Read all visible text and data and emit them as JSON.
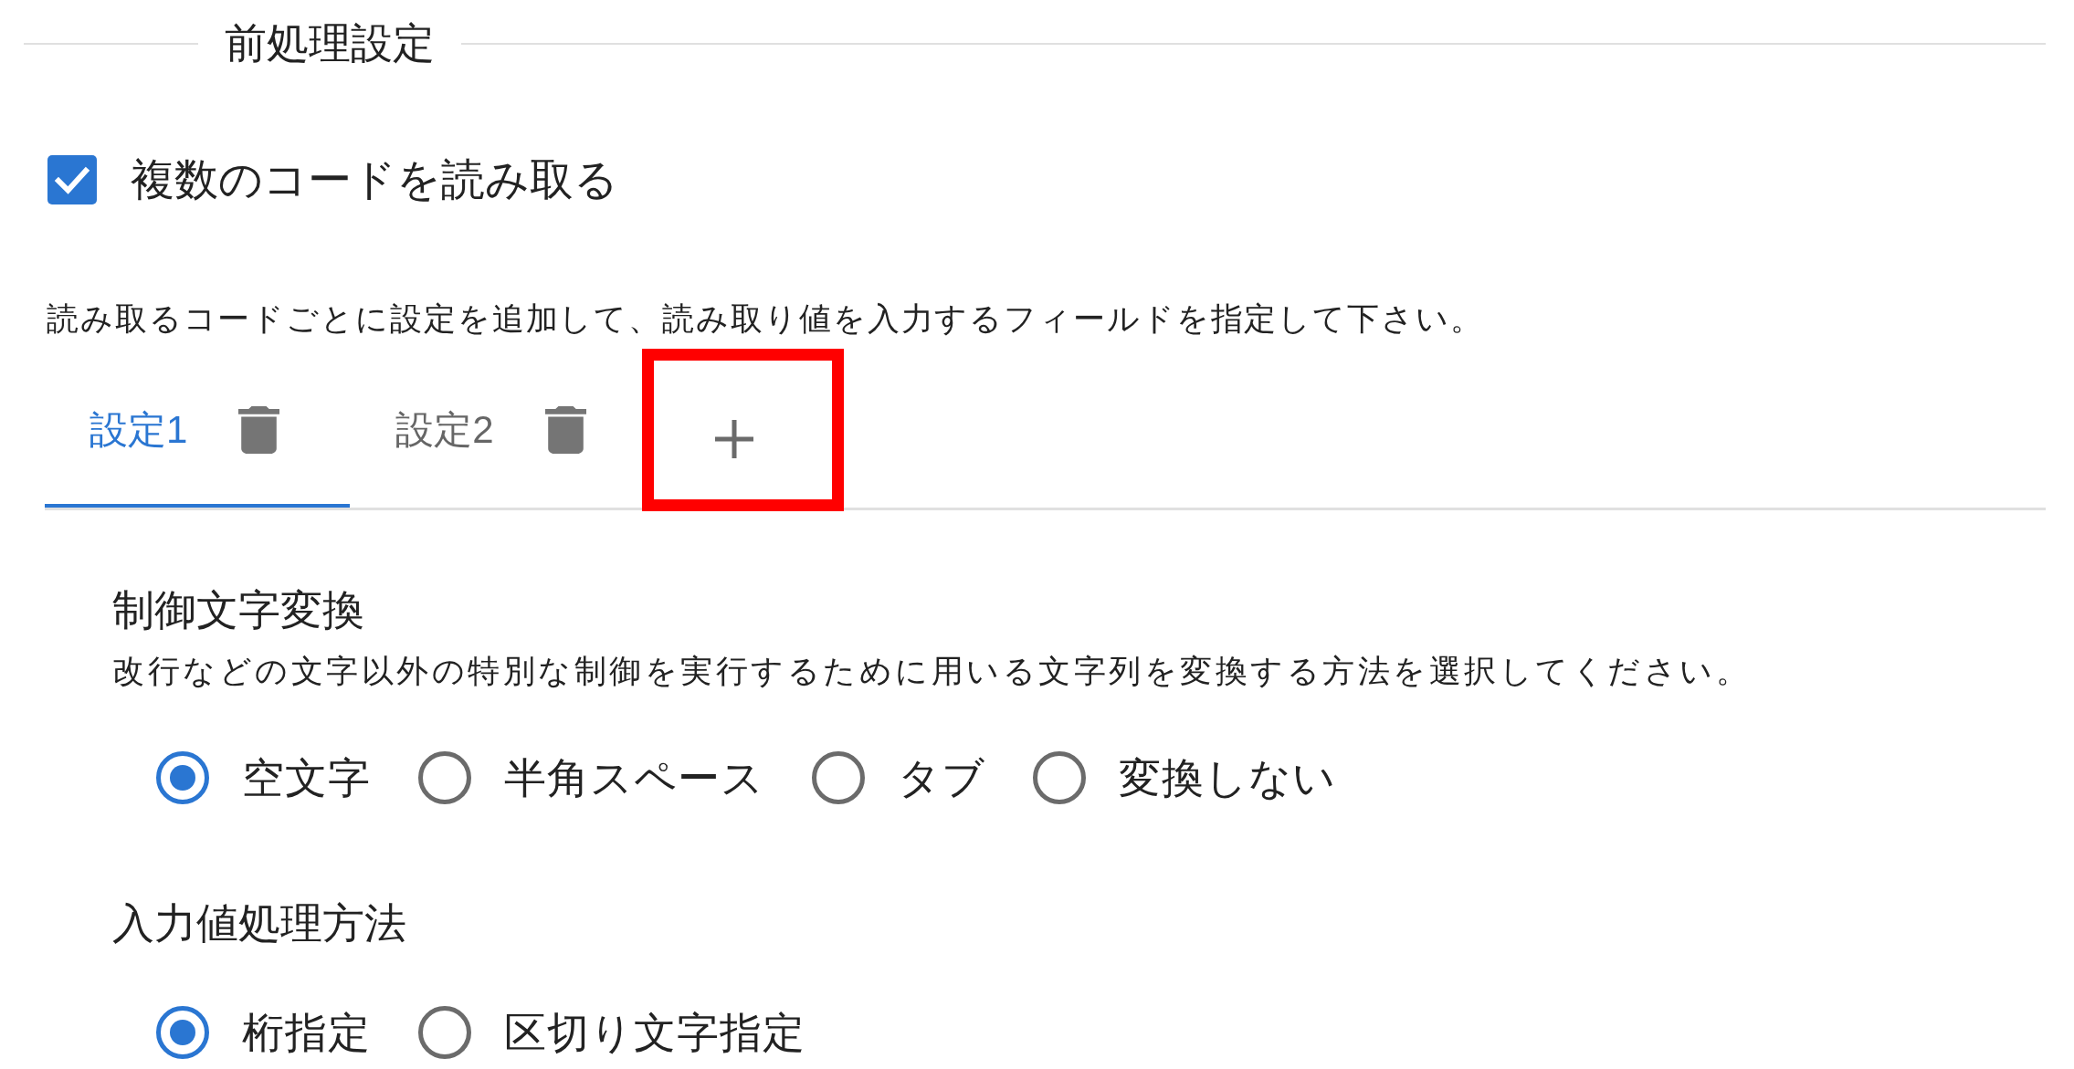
{
  "section": {
    "title": "前処理設定"
  },
  "multi_read": {
    "label": "複数のコードを読み取る",
    "checked": true
  },
  "description": "読み取るコードごとに設定を追加して、読み取り値を入力するフィールドを指定して下さい。",
  "tabs": [
    {
      "label": "設定1",
      "selected": true
    },
    {
      "label": "設定2",
      "selected": false
    }
  ],
  "add_tab": {
    "highlighted": true
  },
  "groups": [
    {
      "heading": "制御文字変換",
      "description": "改行などの文字以外の特別な制御を実行するために用いる文字列を変換する方法を選択してください。",
      "options": [
        {
          "label": "空文字",
          "selected": true
        },
        {
          "label": "半角スペース",
          "selected": false
        },
        {
          "label": "タブ",
          "selected": false
        },
        {
          "label": "変換しない",
          "selected": false
        }
      ]
    },
    {
      "heading": "入力値処理方法",
      "options": [
        {
          "label": "桁指定",
          "selected": true
        },
        {
          "label": "区切り文字指定",
          "selected": false
        }
      ]
    }
  ]
}
